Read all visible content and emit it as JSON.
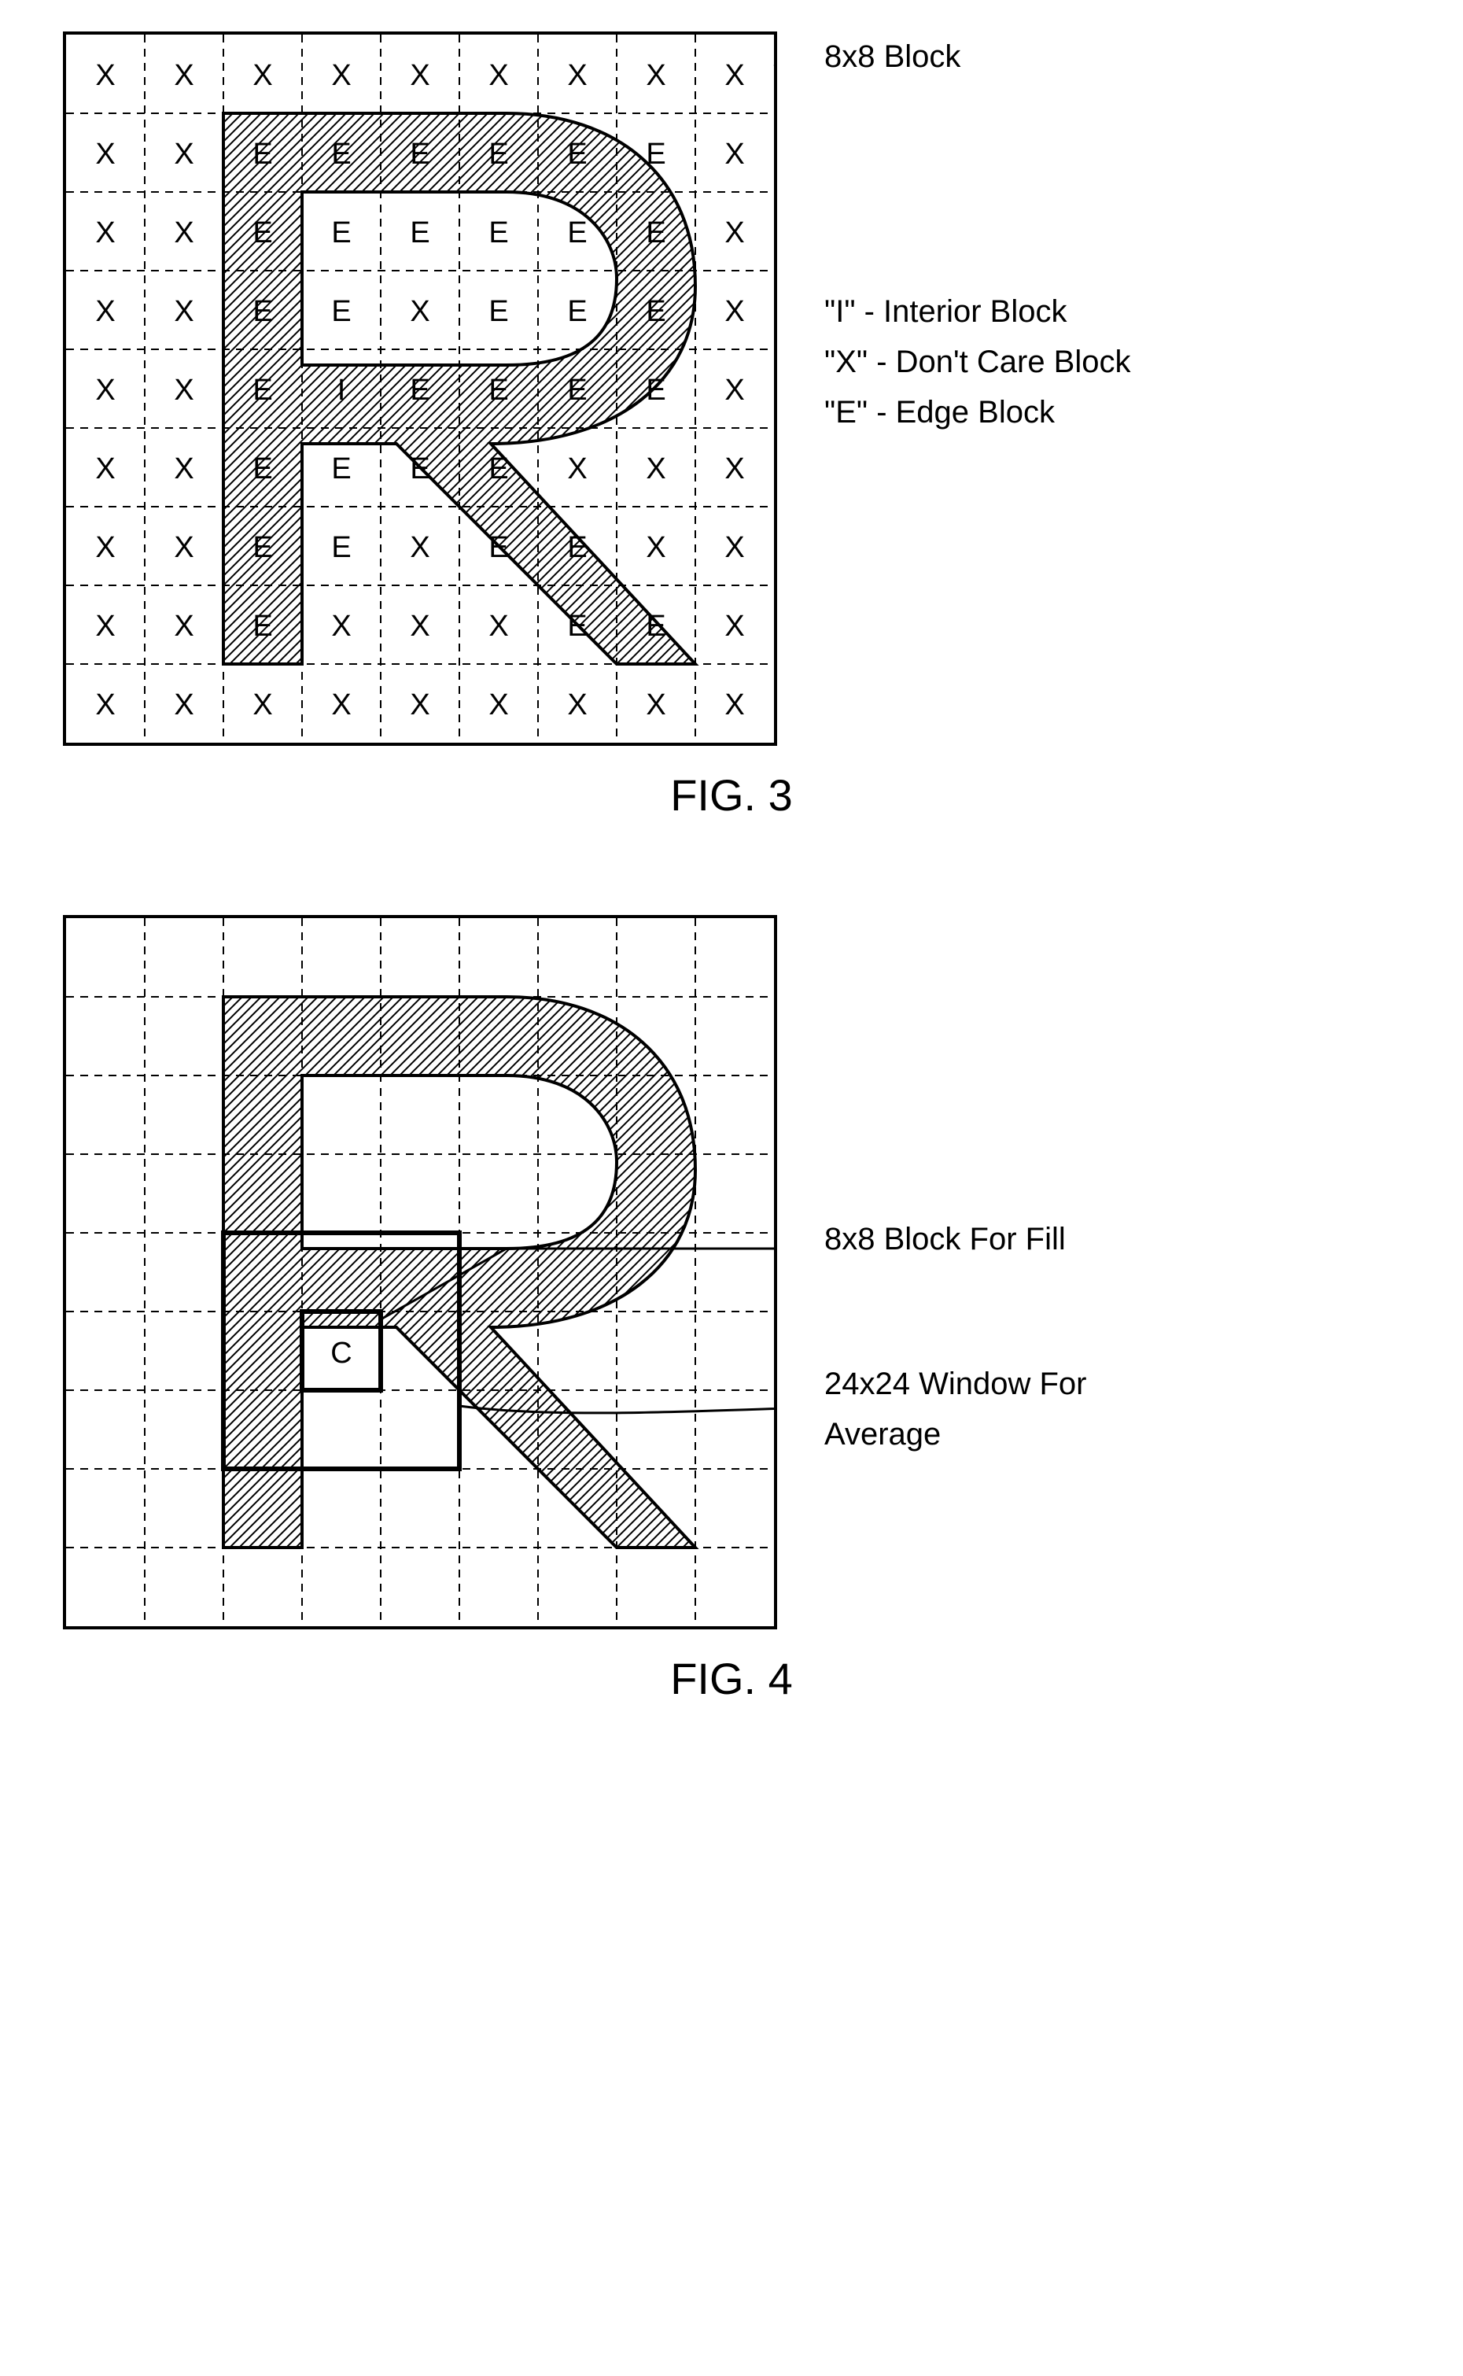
{
  "fig3": {
    "caption": "FIG. 3",
    "block_annot": "8x8 Block",
    "legend": {
      "i": "\"I\" - Interior Block",
      "x": "\"X\" - Don't Care Block",
      "e": "\"E\" - Edge Block"
    },
    "grid_n": 9,
    "cells": [
      [
        "X",
        "X",
        "X",
        "X",
        "X",
        "X",
        "X",
        "X",
        "X"
      ],
      [
        "X",
        "X",
        "E",
        "E",
        "E",
        "E",
        "E",
        "E",
        "X"
      ],
      [
        "X",
        "X",
        "E",
        "E",
        "E",
        "E",
        "E",
        "E",
        "X"
      ],
      [
        "X",
        "X",
        "E",
        "E",
        "X",
        "E",
        "E",
        "E",
        "X"
      ],
      [
        "X",
        "X",
        "E",
        "I",
        "E",
        "E",
        "E",
        "E",
        "X"
      ],
      [
        "X",
        "X",
        "E",
        "E",
        "E",
        "E",
        "X",
        "X",
        "X"
      ],
      [
        "X",
        "X",
        "E",
        "E",
        "X",
        "E",
        "E",
        "X",
        "X"
      ],
      [
        "X",
        "X",
        "E",
        "X",
        "X",
        "X",
        "E",
        "E",
        "X"
      ],
      [
        "X",
        "X",
        "X",
        "X",
        "X",
        "X",
        "X",
        "X",
        "X"
      ]
    ]
  },
  "fig4": {
    "caption": "FIG. 4",
    "grid_n": 9,
    "annot_fill": "8x8 Block For Fill",
    "annot_window": "24x24 Window For Average",
    "center_label": "C"
  },
  "chart_data": {
    "type": "table",
    "title": "FIG.3 block-classification grid for letter R",
    "rows": 9,
    "cols": 9,
    "legend": {
      "I": "Interior",
      "X": "Don't Care",
      "E": "Edge"
    },
    "cells": [
      [
        "X",
        "X",
        "X",
        "X",
        "X",
        "X",
        "X",
        "X",
        "X"
      ],
      [
        "X",
        "X",
        "E",
        "E",
        "E",
        "E",
        "E",
        "E",
        "X"
      ],
      [
        "X",
        "X",
        "E",
        "E",
        "E",
        "E",
        "E",
        "E",
        "X"
      ],
      [
        "X",
        "X",
        "E",
        "E",
        "X",
        "E",
        "E",
        "E",
        "X"
      ],
      [
        "X",
        "X",
        "E",
        "I",
        "E",
        "E",
        "E",
        "E",
        "X"
      ],
      [
        "X",
        "X",
        "E",
        "E",
        "E",
        "E",
        "X",
        "X",
        "X"
      ],
      [
        "X",
        "X",
        "E",
        "E",
        "X",
        "E",
        "E",
        "X",
        "X"
      ],
      [
        "X",
        "X",
        "E",
        "X",
        "X",
        "X",
        "E",
        "E",
        "X"
      ],
      [
        "X",
        "X",
        "X",
        "X",
        "X",
        "X",
        "X",
        "X",
        "X"
      ]
    ]
  }
}
